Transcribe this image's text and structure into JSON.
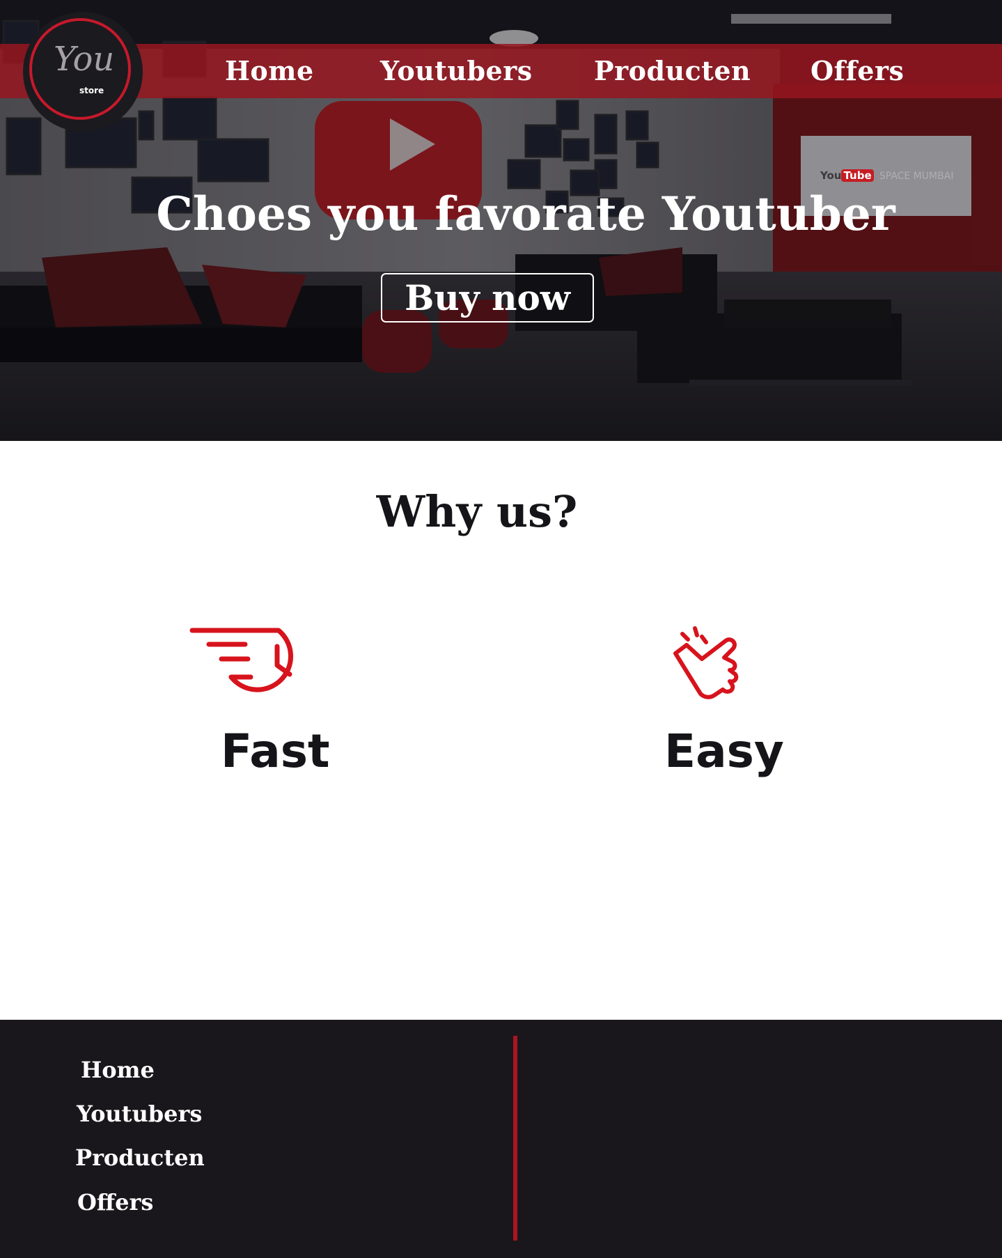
{
  "brand": {
    "logo_script": "You",
    "logo_sub": "store"
  },
  "nav": {
    "items": [
      {
        "label": "Home"
      },
      {
        "label": "Youtubers"
      },
      {
        "label": "Producten"
      },
      {
        "label": "Offers"
      }
    ]
  },
  "hero": {
    "title": "Choes you favorate Youtuber",
    "cta_label": "Buy now",
    "tv_logo_you": "You",
    "tv_logo_tube": "Tube",
    "tv_caption": "SPACE MUMBAI"
  },
  "why": {
    "title": "Why us?",
    "features": [
      {
        "label": "Fast",
        "icon": "fast-clock-icon"
      },
      {
        "label": "Easy",
        "icon": "snap-hand-icon"
      }
    ]
  },
  "footer": {
    "links": [
      {
        "label": "Home"
      },
      {
        "label": "Youtubers"
      },
      {
        "label": "Producten"
      },
      {
        "label": "Offers"
      }
    ]
  },
  "colors": {
    "accent": "#c6192b",
    "nav_bar": "#961620",
    "footer_bg": "#19171b",
    "icon_red": "#d7131c"
  }
}
